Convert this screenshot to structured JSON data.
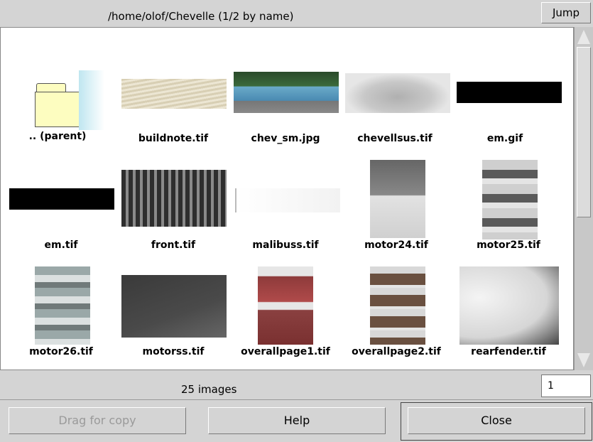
{
  "header": {
    "title": "/home/olof/Chevelle (1/2 by name)",
    "jump_label": "Jump"
  },
  "grid": {
    "items": [
      {
        "label": ".. (parent)",
        "kind": "folder-icon"
      },
      {
        "label": "buildnote.tif",
        "kind": "image-thumbnail"
      },
      {
        "label": "chev_sm.jpg",
        "kind": "image-thumbnail"
      },
      {
        "label": "chevellsus.tif",
        "kind": "image-thumbnail"
      },
      {
        "label": "em.gif",
        "kind": "image-thumbnail"
      },
      {
        "label": "em.tif",
        "kind": "image-thumbnail"
      },
      {
        "label": "front.tif",
        "kind": "image-thumbnail"
      },
      {
        "label": "malibuss.tif",
        "kind": "image-thumbnail"
      },
      {
        "label": "motor24.tif",
        "kind": "image-thumbnail"
      },
      {
        "label": "motor25.tif",
        "kind": "image-thumbnail"
      },
      {
        "label": "motor26.tif",
        "kind": "image-thumbnail"
      },
      {
        "label": "motorss.tif",
        "kind": "image-thumbnail"
      },
      {
        "label": "overallpage1.tif",
        "kind": "image-thumbnail"
      },
      {
        "label": "overallpage2.tif",
        "kind": "image-thumbnail"
      },
      {
        "label": "rearfender.tif",
        "kind": "image-thumbnail"
      }
    ]
  },
  "footer": {
    "count_text": "25 images",
    "page_value": "1"
  },
  "buttons": {
    "drag_label": "Drag for copy",
    "help_label": "Help",
    "close_label": "Close"
  }
}
